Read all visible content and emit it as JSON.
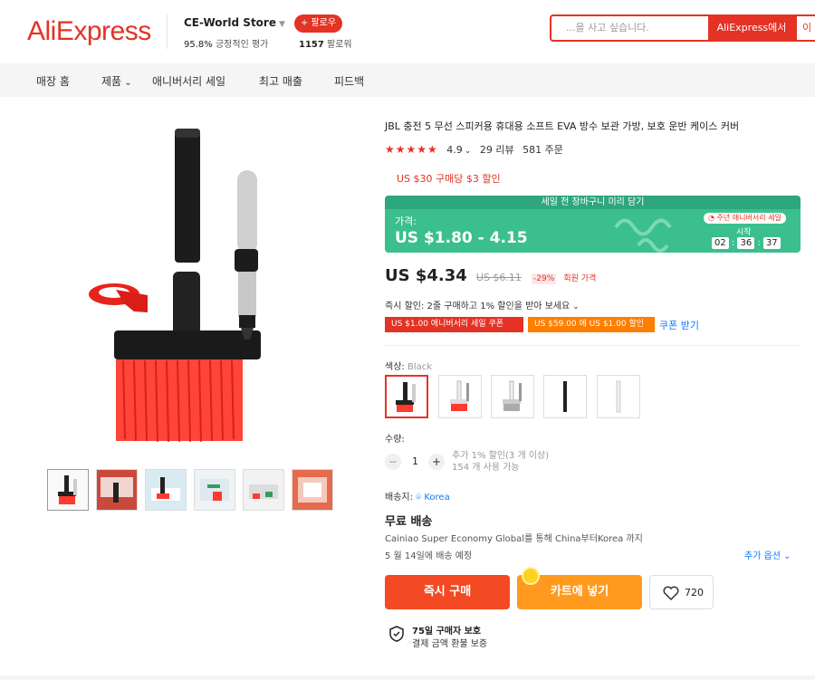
{
  "header": {
    "logo": "AliExpress",
    "store_name": "CE-World Store",
    "store_rating_value": "95.8%",
    "store_rating_text": "긍정적인 평가",
    "follow_label": "+ 팔로우",
    "followers_count": "1157",
    "followers_text": "팔로워",
    "search_placeholder": "...을 사고 싶습니다.",
    "search_button": "AliExpress에서",
    "search_button2": "이"
  },
  "nav": {
    "items": [
      "매장 홈",
      "제품",
      "애니버서리 세일",
      "최고 매출",
      "피드백"
    ]
  },
  "product": {
    "title": "JBL 충전 5 무선 스피커용 휴대용 소프트 EVA 방수 보관 가방, 보호 운반 케이스 커버",
    "rating": "4.9",
    "reviews": "29 리뷰",
    "orders": "581 주문",
    "coupon_note": "US $30 구매당 $3 할인",
    "promo": {
      "banner": "세일 전 장바구니 미리 담기",
      "label": "가격:",
      "price": "US $1.80 - 4.15",
      "badge": "주년 애니버서리 세일",
      "start": "시작",
      "timer": [
        "02",
        "36",
        "37"
      ]
    },
    "price": "US $4.34",
    "old_price": "US $6.11",
    "discount": "-29%",
    "member_price": "회원 가격",
    "instant_discount": "즉시 할인: 2줄 구매하고 1% 할인을 받아 보세요",
    "coupon_red": "US $1.00 애니버서리 세일 쿠폰",
    "coupon_orange": "US $59.00 에 US $1.00 할인",
    "coupon_link": "쿠폰 받기",
    "color_label": "색상:",
    "color_value": "Black",
    "quantity_label": "수량:",
    "quantity": "1",
    "qty_note_1": "추가 1% 할인(3 개 이상)",
    "qty_note_2": "154 개 사용 가능",
    "ship_to_label": "배송지:",
    "ship_to_location": "Korea",
    "free_shipping": "무료 배송",
    "ship_desc": "Cainiao Super Economy Global를 통해 China부터Korea 까지",
    "ship_date": "5 월 14일에 배송 예정",
    "more_options": "추가 옵션",
    "buy_now": "즉시 구매",
    "add_to_cart": "카트에 넣기",
    "wishlist_count": "720",
    "protection_title": "75일 구매자 보호",
    "protection_sub": "결제 금액 환불 보증"
  },
  "colors": {
    "brand": "#e43225",
    "promo_green": "#3bbf8f",
    "buy_button": "#f34a23",
    "cart_button": "#ff9a1f",
    "link_blue": "#1677ff"
  }
}
